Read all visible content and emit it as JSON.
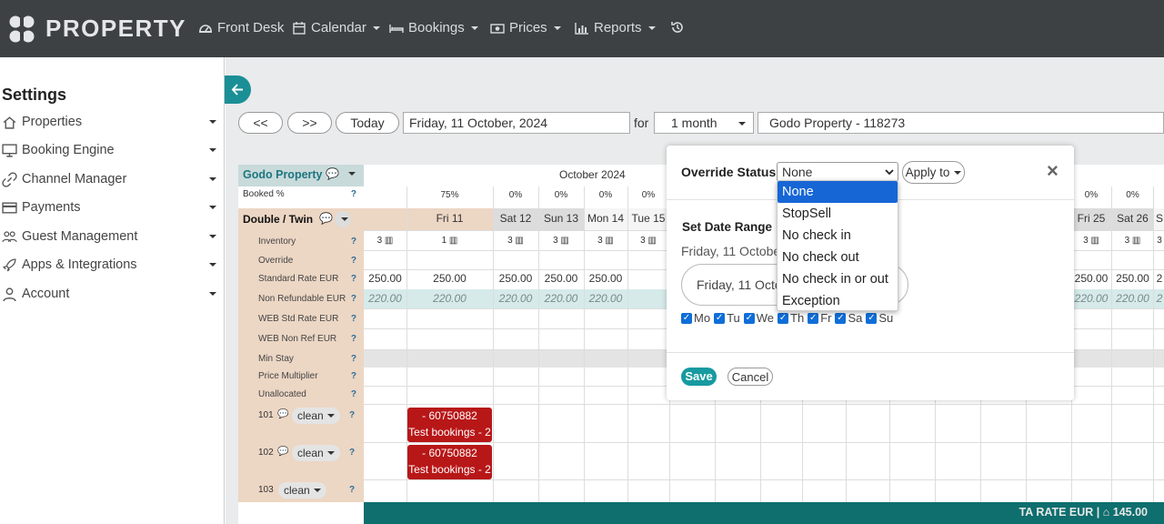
{
  "app": {
    "logo_text": "PROPERTY"
  },
  "nav": [
    {
      "label": "Front Desk",
      "icon": "dashboard-icon"
    },
    {
      "label": "Calendar",
      "icon": "calendar-icon"
    },
    {
      "label": "Bookings",
      "icon": "bed-icon"
    },
    {
      "label": "Prices",
      "icon": "money-icon"
    },
    {
      "label": "Reports",
      "icon": "chart-icon"
    }
  ],
  "sidebar": {
    "title": "Settings",
    "items": [
      {
        "label": "Properties",
        "icon": "home-icon"
      },
      {
        "label": "Booking Engine",
        "icon": "monitor-icon"
      },
      {
        "label": "Channel Manager",
        "icon": "link-icon"
      },
      {
        "label": "Payments",
        "icon": "card-icon"
      },
      {
        "label": "Guest Management",
        "icon": "users-icon"
      },
      {
        "label": "Apps & Integrations",
        "icon": "rocket-icon"
      },
      {
        "label": "Account",
        "icon": "user-icon"
      }
    ]
  },
  "toolbar": {
    "prev_label": "<<",
    "next_label": ">>",
    "today_label": "Today",
    "date_value": "Friday, 11 October, 2024",
    "for_label": "for",
    "range_value": "1 month",
    "property_value": "Godo Property - 118273"
  },
  "grid": {
    "property_label": "Godo Property",
    "month_label": "October 2024",
    "booked_label": "Booked %",
    "room_type_label": "Double / Twin",
    "row_labels": [
      "Inventory",
      "Override",
      "Standard Rate EUR",
      "Non Refundable EUR",
      "WEB Std Rate EUR",
      "WEB Non Ref EUR",
      "Min Stay",
      "Price Multiplier",
      "Unallocated"
    ],
    "help_mark": "?",
    "dates": [
      "Fri 11",
      "Sat 12",
      "Sun 13",
      "Mon 14",
      "Tue 15",
      "Fri 25",
      "Sat 26",
      "S"
    ],
    "booked": [
      "75%",
      "0%",
      "0%",
      "0%",
      "0%",
      "0%",
      "0%"
    ],
    "inventory": [
      "3",
      "1",
      "3",
      "3",
      "3",
      "3",
      "3",
      "3",
      "3"
    ],
    "std_rates": [
      "250.00",
      "250.00",
      "250.00",
      "250.00",
      "250.00",
      "250.00",
      "250.00",
      "2"
    ],
    "nonref_rates": [
      "220.00",
      "220.00",
      "220.00",
      "220.00",
      "220.00",
      "220.00",
      "220.00",
      "2"
    ],
    "rooms": [
      {
        "number": "101",
        "status": "clean"
      },
      {
        "number": "102",
        "status": "clean"
      },
      {
        "number": "103",
        "status": "clean"
      }
    ],
    "bookings": [
      {
        "id": "- 60750882",
        "name": "Test bookings - 2"
      },
      {
        "id": "- 60750882",
        "name": "Test bookings - 2"
      }
    ],
    "footer": "TA RATE EUR | ⌂ 145.00"
  },
  "modal": {
    "override_label": "Override Status",
    "override_value": "None",
    "apply_to_label": "Apply to",
    "close_label": "×",
    "date_range_label": "Set Date Range",
    "date_text": "Friday, 11 October",
    "date_pill_text": "Friday, 11 Octo",
    "days": [
      "Mo",
      "Tu",
      "We",
      "Th",
      "Fr",
      "Sa",
      "Su"
    ],
    "save_label": "Save",
    "cancel_label": "Cancel",
    "options": [
      "None",
      "StopSell",
      "No check in",
      "No check out",
      "No check in or out",
      "Exception"
    ]
  },
  "colors": {
    "topbar": "#3d4143",
    "accent": "#1a8f96",
    "booking": "#b81718",
    "select_highlight": "#1666d6"
  }
}
